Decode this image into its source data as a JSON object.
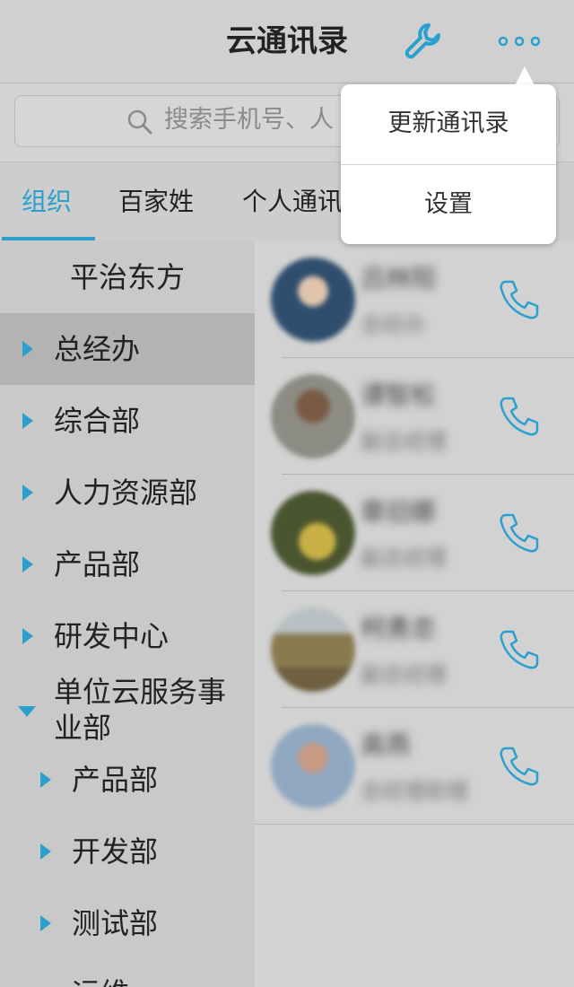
{
  "header": {
    "title": "云通讯录"
  },
  "search": {
    "placeholder": "搜索手机号、人"
  },
  "tabs": [
    {
      "label": "组织",
      "active": true
    },
    {
      "label": "百家姓",
      "active": false
    },
    {
      "label": "个人通讯"
    }
  ],
  "org": {
    "root": "平治东方",
    "departments": [
      {
        "label": "总经办",
        "expanded": false,
        "selected": true,
        "level": 0
      },
      {
        "label": "综合部",
        "expanded": false,
        "level": 0
      },
      {
        "label": "人力资源部",
        "expanded": false,
        "level": 0
      },
      {
        "label": "产品部",
        "expanded": false,
        "level": 0
      },
      {
        "label": "研发中心",
        "expanded": false,
        "level": 0
      },
      {
        "label": "单位云服务事业部",
        "expanded": true,
        "level": 0
      },
      {
        "label": "产品部",
        "expanded": false,
        "level": 1
      },
      {
        "label": "开发部",
        "expanded": false,
        "level": 1
      },
      {
        "label": "测试部",
        "expanded": false,
        "level": 1
      },
      {
        "label": "运维",
        "expanded": false,
        "level": 1
      }
    ]
  },
  "contacts": [
    {
      "name": "吕林阳",
      "dept": "总经办",
      "avatar_color": "#2f4e6e"
    },
    {
      "name": "谭智松",
      "dept": "副总经理",
      "avatar_color": "#6e5a48"
    },
    {
      "name": "章旧娜",
      "dept": "副总经理",
      "avatar_color": "#5f6a3a"
    },
    {
      "name": "柯勇忠",
      "dept": "副总经理",
      "avatar_color": "#7a6e55"
    },
    {
      "name": "高燕",
      "dept": "总经理助理",
      "avatar_color": "#8a7060"
    }
  ],
  "menu": {
    "items": [
      {
        "label": "更新通讯录"
      },
      {
        "label": "设置"
      }
    ]
  },
  "colors": {
    "accent": "#2ba0cf",
    "overlay_background": "#d2d2d2",
    "popup_background": "#ffffff"
  },
  "icons": {
    "header_tool": "wrench-icon",
    "header_more": "more-dots-icon",
    "search": "search-icon",
    "contact_action": "phone-icon"
  }
}
